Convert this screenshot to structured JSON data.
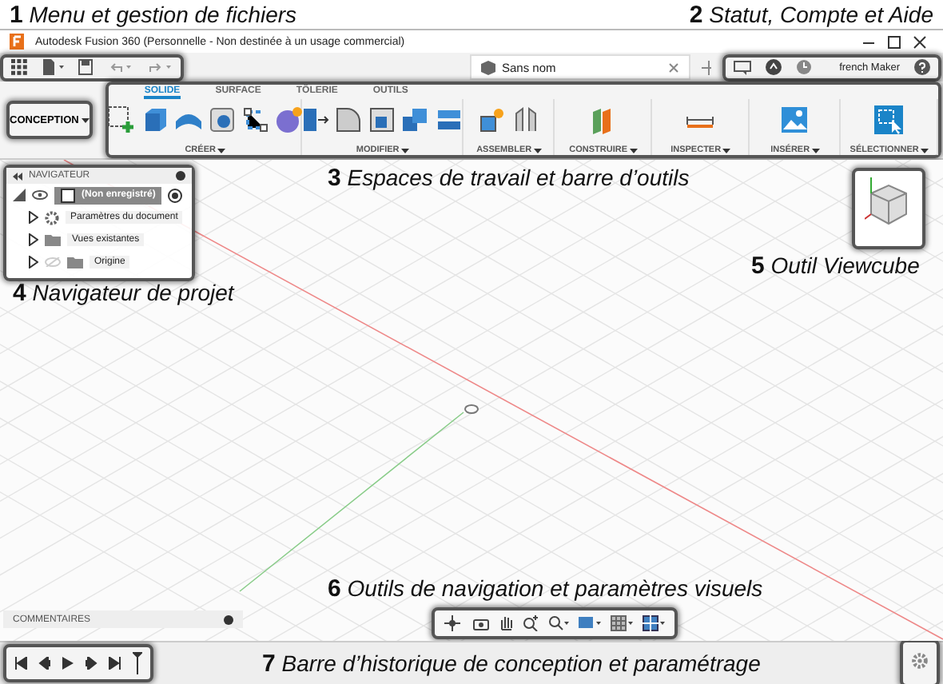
{
  "annotations": [
    {
      "number": "1",
      "text": "Menu et gestion de fichiers"
    },
    {
      "number": "2",
      "text": "Statut, Compte et Aide"
    },
    {
      "number": "3",
      "text": "Espaces de travail et barre d’outils"
    },
    {
      "number": "4",
      "text": "Navigateur de projet"
    },
    {
      "number": "5",
      "text": "Outil Viewcube"
    },
    {
      "number": "6",
      "text": "Outils de navigation et paramètres visuels"
    },
    {
      "number": "7",
      "text": "Barre d’historique de conception et paramétrage"
    }
  ],
  "window": {
    "title": "Autodesk Fusion 360 (Personnelle - Non destinée à un usage commercial)"
  },
  "document_tab": {
    "label": "Sans nom"
  },
  "account": {
    "user": "french Maker"
  },
  "workspace": {
    "label": "CONCEPTION"
  },
  "ribbon_tabs": [
    {
      "label": "SOLIDE",
      "selected": true
    },
    {
      "label": "SURFACE",
      "selected": false
    },
    {
      "label": "TÔLERIE",
      "selected": false
    },
    {
      "label": "OUTILS",
      "selected": false
    }
  ],
  "tool_groups": [
    {
      "label": "CRÉER"
    },
    {
      "label": "MODIFIER"
    },
    {
      "label": "ASSEMBLER"
    },
    {
      "label": "CONSTRUIRE"
    },
    {
      "label": "INSPECTER"
    },
    {
      "label": "INSÉRER"
    },
    {
      "label": "SÉLECTIONNER"
    }
  ],
  "navigator": {
    "title": "NAVIGATEUR",
    "root": {
      "label": "(Non enregistré)",
      "selected": true,
      "children": [
        {
          "kind": "settings",
          "label": "Paramètres du document",
          "selected": false
        },
        {
          "kind": "folder",
          "label": "Vues existantes",
          "selected": false
        },
        {
          "kind": "folder",
          "label": "Origine",
          "selected": false,
          "visible": false
        }
      ]
    }
  },
  "comments": {
    "title": "COMMENTAIRES"
  }
}
